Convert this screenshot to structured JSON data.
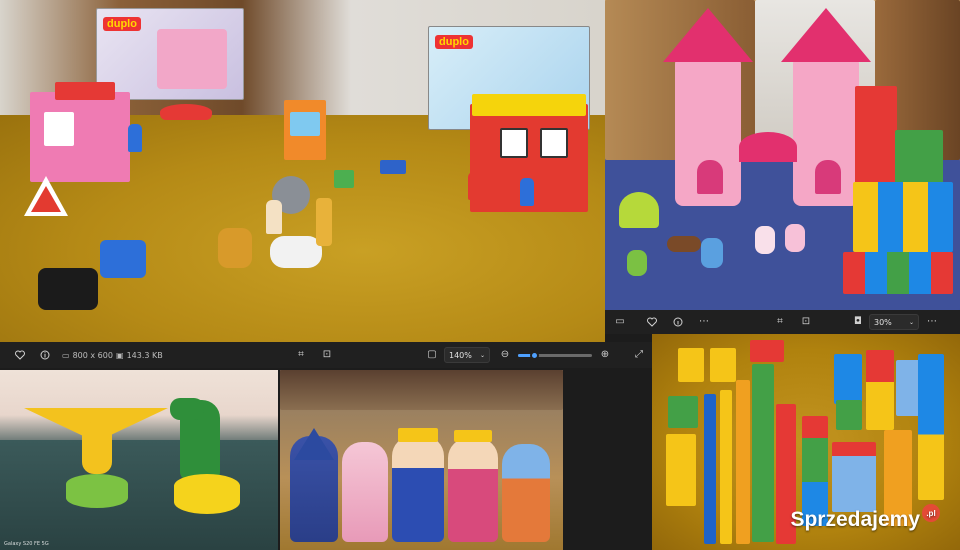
{
  "collage": {
    "watermark": {
      "text": "Sprzedajemy",
      "badge": ".pl"
    },
    "camera_label": "Galaxy S20 FE 5G"
  },
  "viewer_main": {
    "dimensions": "800 x 600",
    "file_size": "143.3 KB",
    "zoom": "140%",
    "zoom_fraction": 0.22,
    "icons": [
      "heart-icon",
      "info-icon",
      "image-icon",
      "save-icon",
      "crop-icon",
      "aspect-icon",
      "fit-window-icon",
      "zoom-out-icon",
      "zoom-in-icon",
      "fullscreen-icon"
    ]
  },
  "viewer_secondary": {
    "zoom": "30%",
    "icons": [
      "fit-window-icon",
      "heart-icon",
      "info-icon",
      "more-icon",
      "crop-icon",
      "aspect-icon",
      "camera-icon",
      "more-icon"
    ]
  },
  "boxes": {
    "duplo_left": "duplo",
    "duplo_right": "duplo"
  },
  "colors": {
    "toolbar_bg": "#202020",
    "accent": "#4ea0ff",
    "watermark_badge": "#e34b36"
  }
}
